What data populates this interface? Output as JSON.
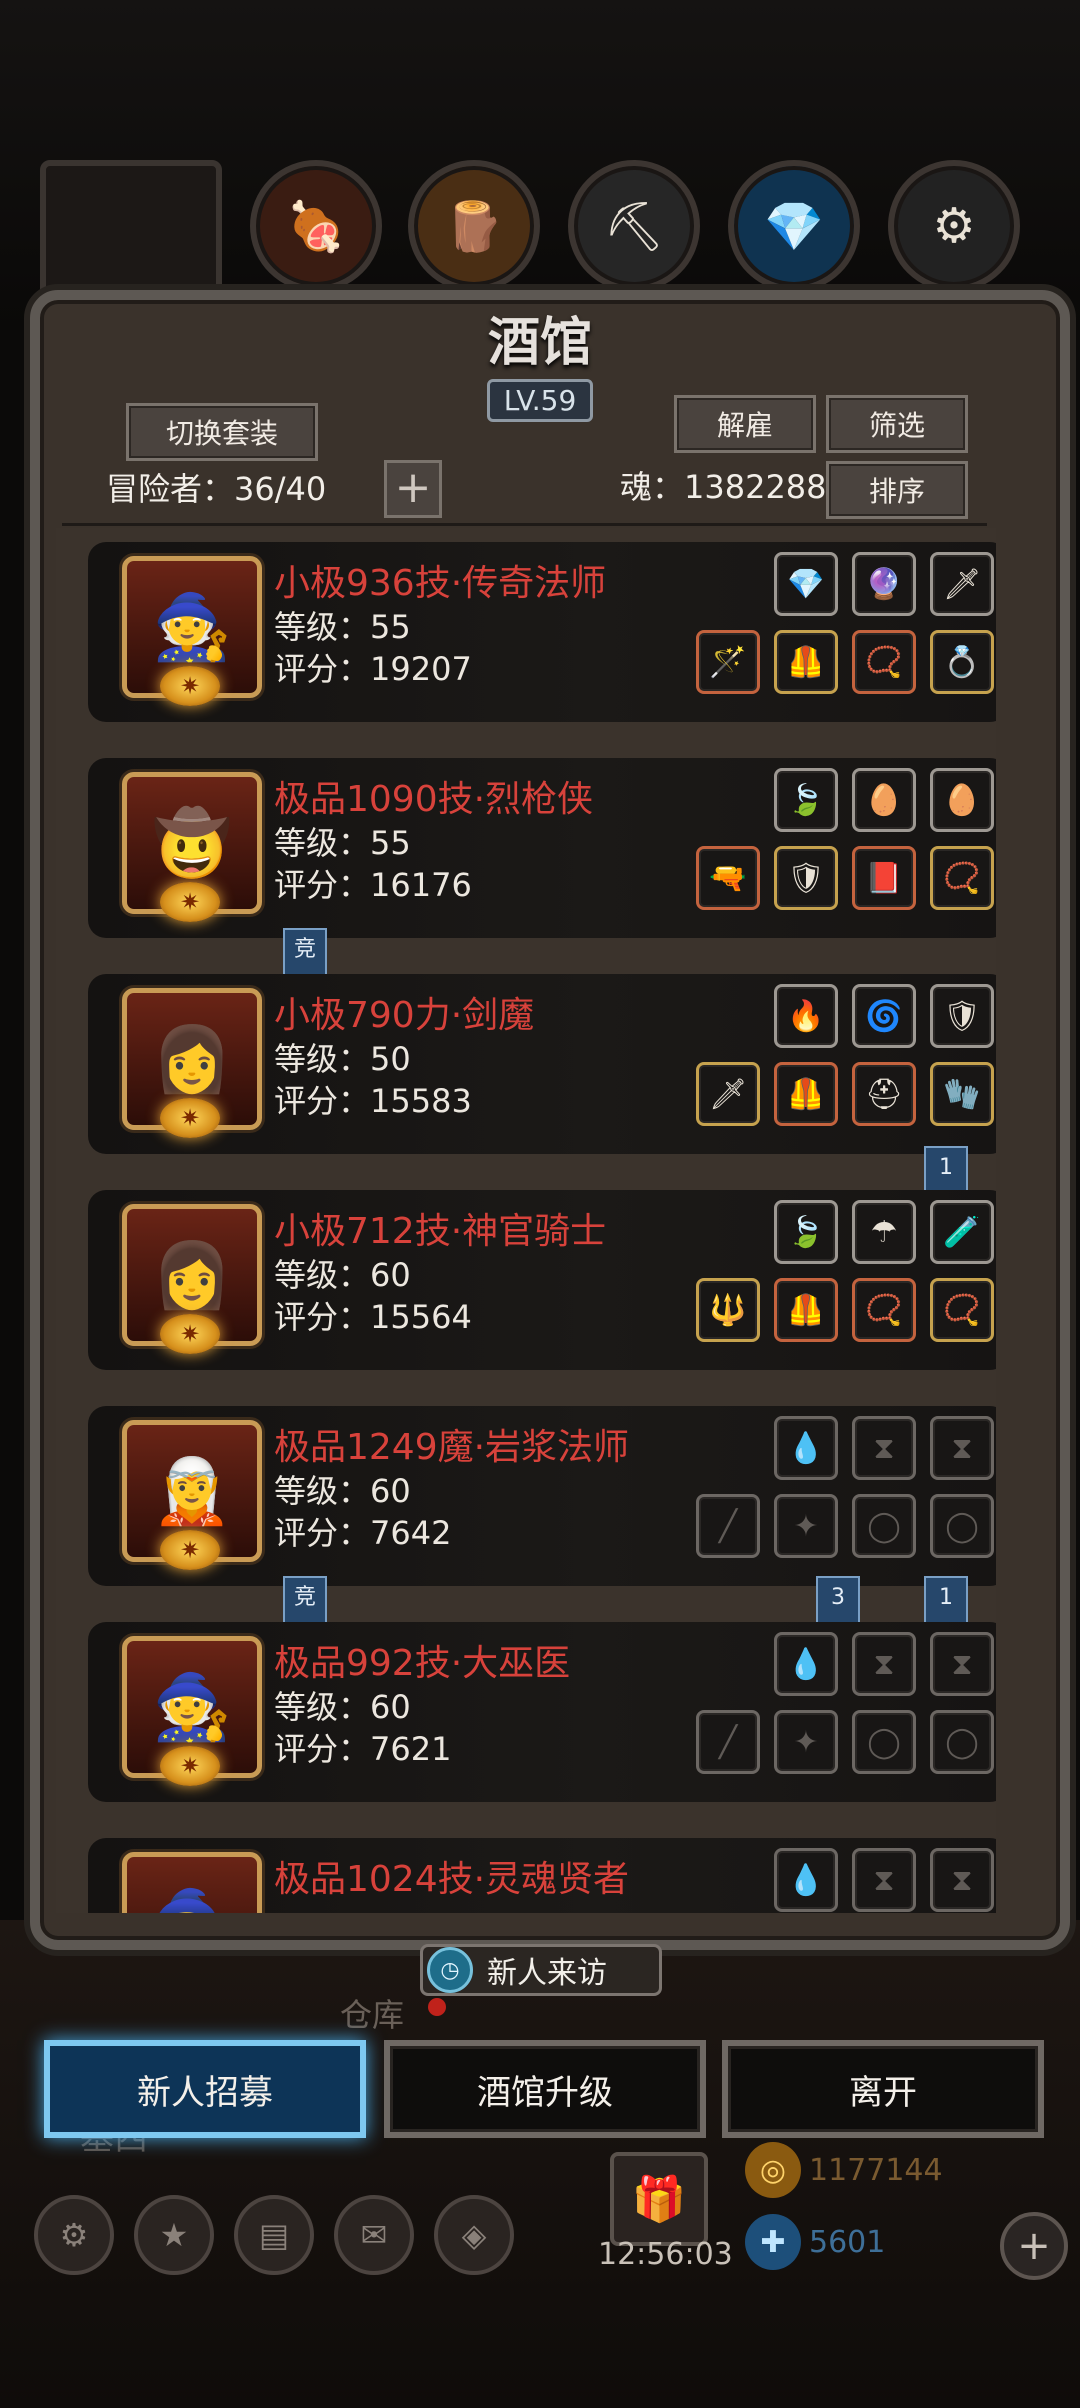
{
  "tavern": {
    "title": "酒馆",
    "level": "LV.59",
    "buttons": {
      "switch_set": "切换套装",
      "dismiss": "解雇",
      "filter": "筛选",
      "sort": "排序",
      "add": "+"
    },
    "adventurers_label": "冒险者：36/40",
    "soul_label": "魂：1382288"
  },
  "heroes": [
    {
      "name": "小极936技·传奇法师",
      "level": "等级：55",
      "score": "评分：19207",
      "portrait": "🧙",
      "top": [
        "💎",
        "🔮",
        "🗡"
      ],
      "bottom": [
        "🪄",
        "🦺",
        "📿",
        "💍"
      ]
    },
    {
      "name": "极品1090技·烈枪侠",
      "level": "等级：55",
      "score": "评分：16176",
      "portrait": "🤠",
      "top": [
        "🍃",
        "🥚",
        "🥚"
      ],
      "bottom": [
        "🔫",
        "🛡",
        "📕",
        "📿"
      ]
    },
    {
      "name": "小极790力·剑魔",
      "level": "等级：50",
      "score": "评分：15583",
      "portrait": "👩",
      "top": [
        "🔥",
        "🌀",
        "🛡"
      ],
      "bottom": [
        "🗡",
        "🦺",
        "⛑",
        "🧤"
      ]
    },
    {
      "name": "小极712技·神官骑士",
      "level": "等级：60",
      "score": "评分：15564",
      "portrait": "👩",
      "top": [
        "🍃",
        "☂",
        "🧪"
      ],
      "bottom": [
        "🔱",
        "🦺",
        "📿",
        "📿"
      ]
    },
    {
      "name": "极品1249魔·岩浆法师",
      "level": "等级：60",
      "score": "评分：7642",
      "portrait": "🧝",
      "top": [
        "💧",
        "⧗",
        "⧗"
      ],
      "bottom": [
        "╱",
        "✦",
        "◯",
        "◯"
      ]
    },
    {
      "name": "极品992技·大巫医",
      "level": "等级：60",
      "score": "评分：7621",
      "portrait": "🧙",
      "top": [
        "💧",
        "⧗",
        "⧗"
      ],
      "bottom": [
        "╱",
        "✦",
        "◯",
        "◯"
      ]
    },
    {
      "name": "极品1024技·灵魂贤者",
      "level": "",
      "score": "",
      "portrait": "🧙",
      "top": [
        "💧",
        "⧗",
        "⧗"
      ],
      "bottom": []
    }
  ],
  "tags": {
    "compete_1": "竞",
    "compete_2": "竞",
    "num_1": "1",
    "num_2": "3",
    "num_3": "1"
  },
  "footer": {
    "new_visitor": "新人来访",
    "recruit": "新人招募",
    "upgrade": "酒馆升级",
    "leave": "离开",
    "warehouse": "仓库",
    "clock": "12:56:03",
    "gold": "1177144",
    "gems": "5601"
  },
  "colors": {
    "name_red": "#d8423b",
    "active_button": "#0d3457"
  }
}
